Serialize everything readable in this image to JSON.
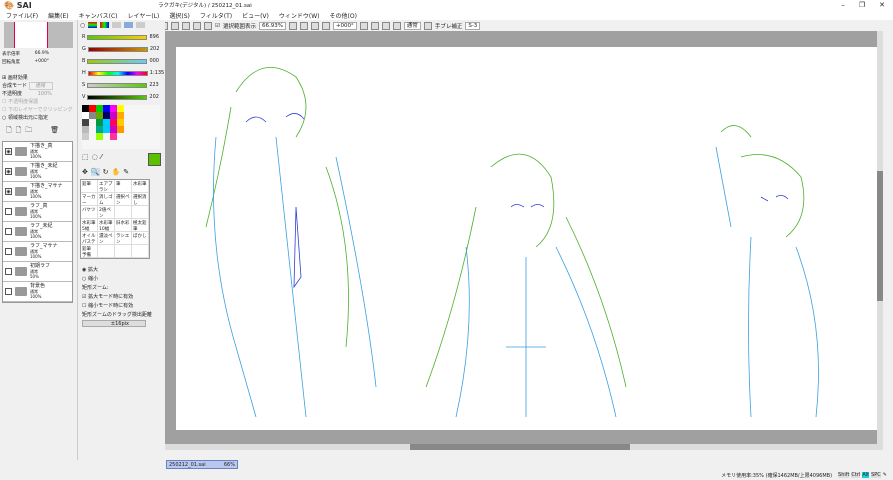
{
  "window": {
    "title": "ラクガキ(デジタル) / 250212_01.sai",
    "app_logo": "PaintTool SAI"
  },
  "menu": [
    "ファイル(F)",
    "編集(E)",
    "キャンバス(C)",
    "レイヤー(L)",
    "選択(S)",
    "フィルタ(T)",
    "ビュー(V)",
    "ウィンドウ(W)",
    "その他(O)"
  ],
  "toolbar": {
    "show_selection": "選択範囲表示",
    "zoom": "66.93%",
    "rotation": "+000°",
    "blend": "通常",
    "stabilizer_label": "手ブレ補正",
    "stabilizer": "S-3"
  },
  "navigator": {
    "zoom_label": "表示倍率",
    "zoom": "66.9%",
    "rotate_label": "回転角度",
    "rotate": "+000°"
  },
  "layer_panel": {
    "texture": "画材効果",
    "blend_label": "合成モード",
    "blend": "通常",
    "opacity_label": "不透明度",
    "opacity": "100%",
    "protect": "不透明度保護",
    "clip": "下のレイヤーでクリッピング",
    "select_source": "領域検出元に指定"
  },
  "layers": [
    {
      "name": "下描き_真",
      "mode": "通常",
      "opacity": "100%",
      "visible": true
    },
    {
      "name": "下描き_未紀",
      "mode": "通常",
      "opacity": "100%",
      "visible": true
    },
    {
      "name": "下描き_マサナ",
      "mode": "通常",
      "opacity": "100%",
      "visible": true
    },
    {
      "name": "ラフ_真",
      "mode": "通常",
      "opacity": "100%",
      "visible": false
    },
    {
      "name": "ラフ_未紀",
      "mode": "通常",
      "opacity": "100%",
      "visible": false
    },
    {
      "name": "ラフ_マサナ",
      "mode": "通常",
      "opacity": "100%",
      "visible": false
    },
    {
      "name": "初期ラフ",
      "mode": "通常",
      "opacity": "50%",
      "visible": false
    },
    {
      "name": "背景色",
      "mode": "通常",
      "opacity": "100%",
      "visible": false
    }
  ],
  "color": {
    "R": "896",
    "G": "202",
    "B": "000",
    "H": "1:135",
    "S": "223",
    "V": "202",
    "current": "#5cc000"
  },
  "tools": [
    "鉛筆",
    "エアブラシ",
    "筆",
    "水彩筆",
    "マーカー",
    "消しゴム",
    "選択ペン",
    "選択消し",
    "バケツ",
    "2値ペン",
    "",
    "",
    "水彩筆 5幅",
    "水彩筆 10幅",
    "旧水彩",
    "極太鉛筆",
    "オイルパステル",
    "濃淡ペン",
    "ラシエン",
    "ぼかし",
    "鉛筆 予備",
    "",
    "",
    ""
  ],
  "zoom_options": {
    "zoom_in": "拡大",
    "zoom_out": "縮小",
    "rect_zoom": "矩形ズーム:",
    "zoom_in_valid": "拡大モード時に有効",
    "zoom_out_valid": "縮小モード時に有効",
    "drag_label": "矩形ズームのドラッグ検出距離",
    "drag": "±16pix"
  },
  "doc_tab": {
    "name": "250212_01.sai",
    "zoom": "66%"
  },
  "status": {
    "memory": "メモリ使用率:35% (確保1462MB/上限4096MB)",
    "keys": [
      "Shift",
      "Ctrl",
      "Alt",
      "SPC"
    ]
  }
}
